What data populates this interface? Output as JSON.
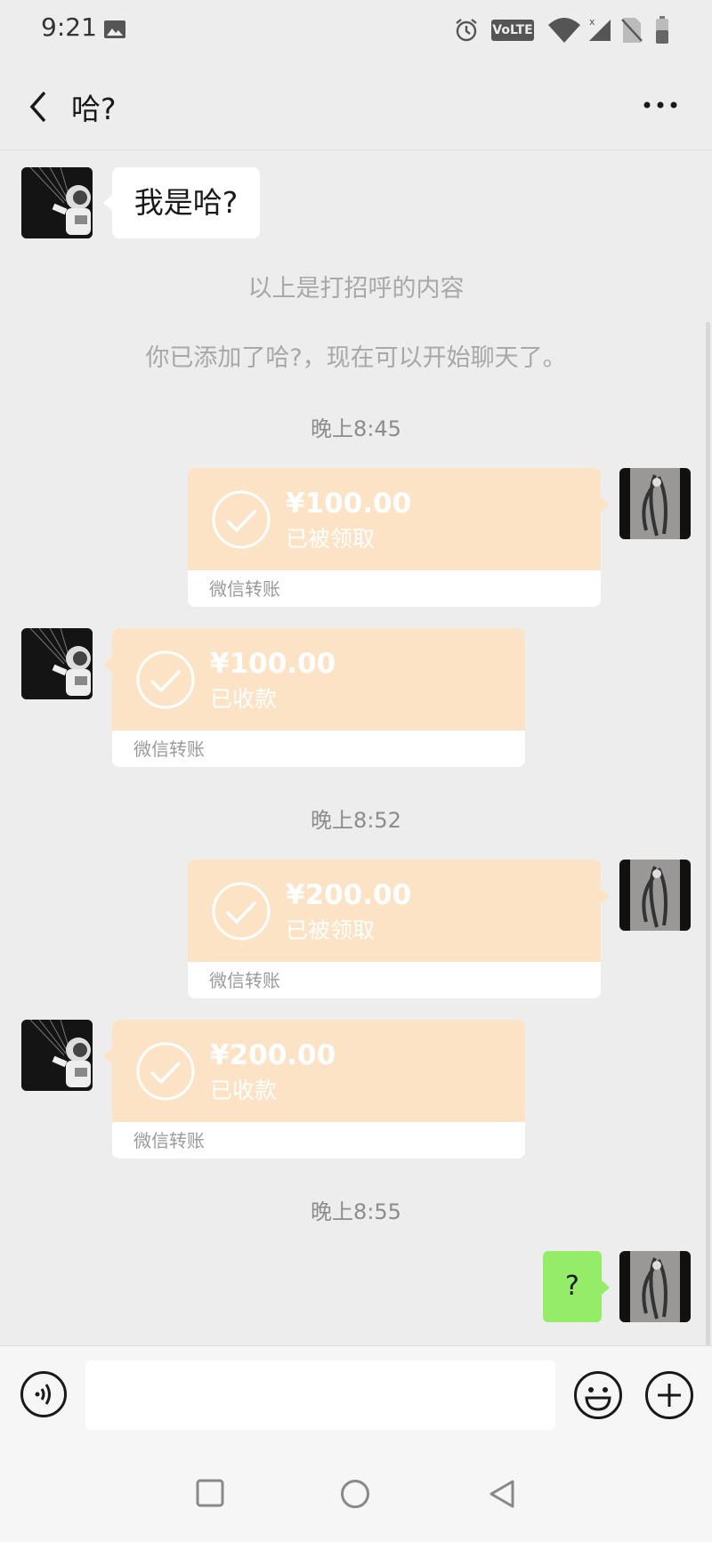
{
  "status_bar": {
    "time": "9:21",
    "icons": [
      "image-icon",
      "alarm-icon",
      "volte-badge",
      "wifi-icon",
      "signal-icon",
      "no-sim-icon",
      "battery-icon"
    ],
    "volte_label": "VoLTE"
  },
  "header": {
    "title": "哈?",
    "back_icon": "chevron-left-icon",
    "more_icon": "more-dots-icon"
  },
  "chat": {
    "greeting": "我是哈?",
    "system_messages": [
      "以上是打招呼的内容",
      "你已添加了哈?，现在可以开始聊天了。"
    ],
    "time_separators": [
      "晚上8:45",
      "晚上8:52",
      "晚上8:55"
    ],
    "transfers": [
      {
        "amount": "¥100.00",
        "status": "已被领取",
        "footer": "微信转账",
        "direction": "sent"
      },
      {
        "amount": "¥100.00",
        "status": "已收款",
        "footer": "微信转账",
        "direction": "received"
      },
      {
        "amount": "¥200.00",
        "status": "已被领取",
        "footer": "微信转账",
        "direction": "sent"
      },
      {
        "amount": "¥200.00",
        "status": "已收款",
        "footer": "微信转账",
        "direction": "received"
      }
    ],
    "last_message": "?"
  },
  "input_bar": {
    "voice_icon": "voice-icon",
    "emoji_icon": "emoji-icon",
    "plus_icon": "plus-icon",
    "text_value": ""
  },
  "nav_bar": {
    "buttons": [
      "recent-apps-icon",
      "home-icon",
      "back-icon"
    ]
  },
  "colors": {
    "background": "#ededed",
    "transfer_bubble": "#fde3c6",
    "own_bubble": "#95ec69",
    "system_text": "#a8a8a8"
  }
}
